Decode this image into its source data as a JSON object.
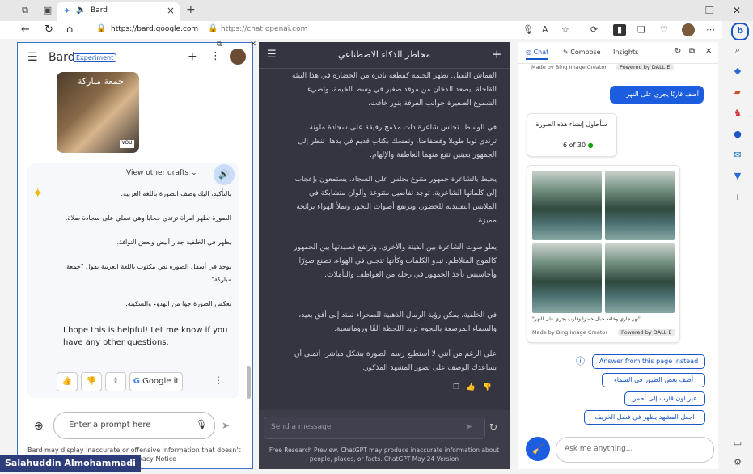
{
  "browser": {
    "tab_title": "Bard",
    "url_bard": "https://bard.google.com",
    "url_gpt": "https://chat.openai.com"
  },
  "bard": {
    "title": "Bard",
    "badge": "Experiment",
    "image_text": "جمعة مباركة",
    "view_drafts": "View other drafts",
    "ar_lines": [
      "بالتأكيد، اليك وصف الصورة باللغة العربية:",
      "الصورة تظهر امرأة ترتدي حجابا وهي تصلي على سجادة صلاة.",
      "يظهر في الخلفية جدار أبيض وبعض النوافذ.",
      "يوجد في أسفل الصورة نص مكتوب باللغة العربية يقول \"جمعة",
      "مباركة\".",
      "تعكس الصورة جوا من الهدوء والسكينة."
    ],
    "en_text": "I hope this is helpful! Let me know if you have any other questions.",
    "google_it": "Google it",
    "prompt_placeholder": "Enter a prompt here",
    "footer": "Bard may display inaccurate or offensive information that doesn't represent Google's views. Bard Privacy Notice"
  },
  "credit": "Salahuddin Almohammadi",
  "gpt": {
    "title": "مخاطر الذكاء الاصطناعي",
    "paragraphs": [
      "القماش الثقيل. تظهر الخيمة كقطعة نادرة من الحضارة في هذا البيئة القاحلة. يصعد الدخان من موقد صغير في وسط الخيمة، وتضيء الشموع الصغيرة جوانب الغرفة بنور خافت.",
      "في الوسط، تجلس شاعرة ذات ملامح رقيقة على سجادة ملونة. ترتدي ثوبا طويلا وفضفاضا، وتمسك بكتاب قديم في يدها. تنظر إلى الجمهور بعينين تتبع منهما العاطفة والإلهام.",
      "يحيط بالشاعرة جمهور متنوع يجلس على السجاد، يستمعون بإعجاب إلى كلماتها الشاعرية. توجد تفاصيل متنوعة وألوان متشابكة في الملابس التقليدية للحضور، وترتفع أصوات البخور وتملأ الهواء برائحة مميزة.",
      "يعلو صوت الشاعرة بين الفينة والأخرى، وترتفع قصيدتها بين الجمهور كالموج المتلاطم. تبدو الكلمات وكأنها تتجلى في الهواء، تصنع صورًا وأحاسيس تأخذ الجمهور في رحلة من العواطف والتأملات.",
      "في الخلفية، يمكن رؤية الرمال الذهبية للصحراء تمتد إلى أفق بعيد، والسماء المرصعة بالنجوم تزيد اللحظة ألقًا ورومانسية.",
      "على الرغم من أنني لا أستطيع رسم الصورة بشكل مباشر، أتمنى أن يساعدك الوصف على تصور المشهد المذكور."
    ],
    "send_placeholder": "Send a message",
    "footer": "Free Research Preview. ChatGPT may produce inaccurate information about people, places, or facts. ChatGPT May 24 Version"
  },
  "bing": {
    "tabs": [
      "Chat",
      "Compose",
      "Insights"
    ],
    "made_by": "Made by Bing Image Creator",
    "powered": "Powered by DALL·E",
    "user_msg": "أضف قاربًا يجري على النهر",
    "bot_msg": "سأحاول إنشاء هذه الصورة.",
    "counter": "6 of 30",
    "caption": "\"نهر جاري وخلفه جبال خضرا وقارب يجري على النهر\"",
    "answer_page": "Answer from this page instead",
    "suggestions": [
      "أضف بعض الطيور في السماء",
      "غير لون قارب إلى أحمر",
      "اجعل المشهد يظهر في فصل الخريف"
    ],
    "ask_placeholder": "Ask me anything..."
  }
}
